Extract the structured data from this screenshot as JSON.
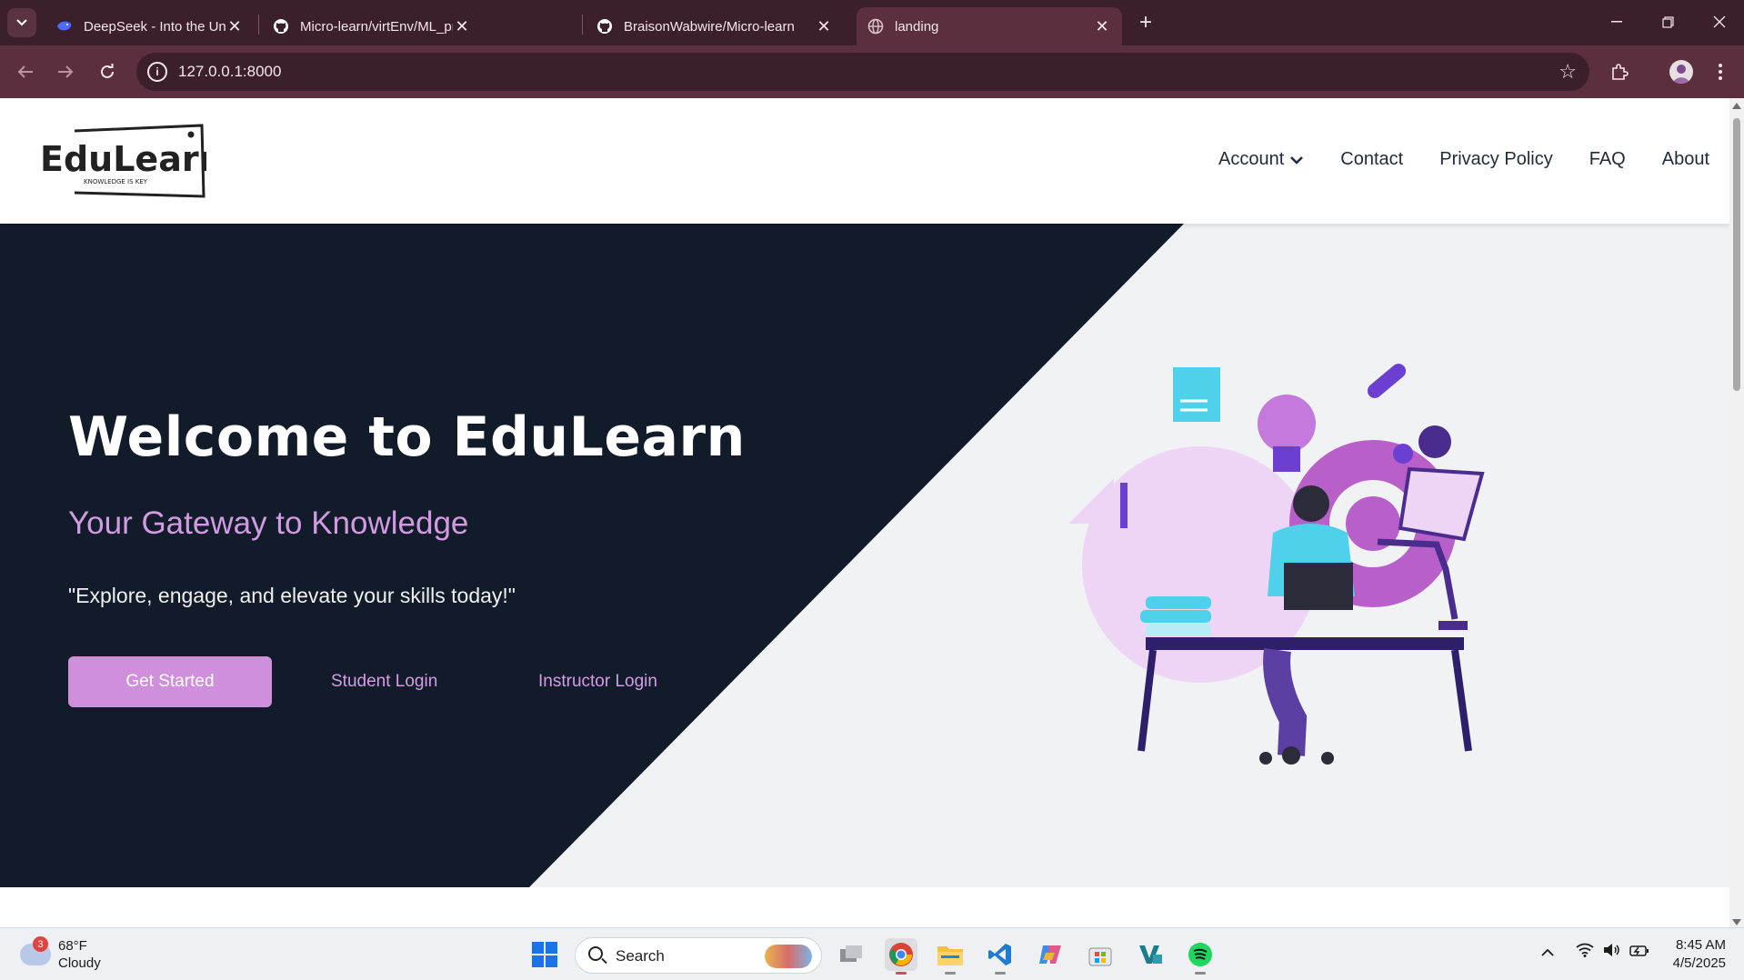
{
  "browser": {
    "tabs": [
      {
        "title": "DeepSeek - Into the Unknown",
        "icon": "deepseek-whale-icon"
      },
      {
        "title": "Micro-learn/virtEnv/ML_project",
        "icon": "github-icon"
      },
      {
        "title": "BraisonWabwire/Micro-learn",
        "icon": "github-icon"
      },
      {
        "title": "landing",
        "icon": "globe-icon"
      }
    ],
    "url": "127.0.0.1:8000"
  },
  "site": {
    "logo": {
      "name": "EduLearn",
      "tagline": "KNOWLEDGE IS KEY"
    },
    "nav": {
      "account": "Account",
      "contact": "Contact",
      "privacy": "Privacy Policy",
      "faq": "FAQ",
      "about": "About"
    },
    "hero": {
      "title": "Welcome to EduLearn",
      "subtitle": "Your Gateway to Knowledge",
      "quote": "\"Explore, engage, and elevate your skills today!\"",
      "get_started": "Get Started",
      "student_login": "Student Login",
      "instructor_login": "Instructor Login"
    },
    "colors": {
      "hero_dark": "#111b29",
      "accent": "#cf8fdb",
      "accent_text": "#d69be5",
      "hero_light": "#f0f2f3"
    }
  },
  "taskbar": {
    "weather": {
      "temp": "68°F",
      "condition": "Cloudy",
      "badge": "3"
    },
    "search_label": "Search",
    "clock": {
      "time": "8:45 AM",
      "date": "4/5/2025"
    }
  }
}
